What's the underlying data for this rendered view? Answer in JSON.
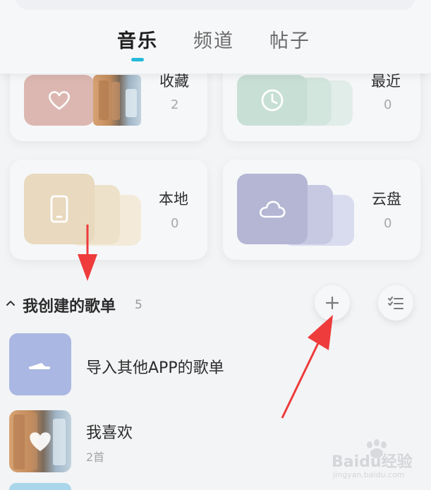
{
  "tabs": [
    {
      "label": "音乐",
      "active": true
    },
    {
      "label": "频道",
      "active": false
    },
    {
      "label": "帖子",
      "active": false
    }
  ],
  "cards": {
    "favorites": {
      "title": "收藏",
      "count": "2",
      "icon": "heart-icon",
      "color": "#dcb7b1"
    },
    "recent": {
      "title": "最近",
      "count": "0",
      "icon": "clock-icon",
      "color": "#c8dfd6"
    },
    "local": {
      "title": "本地",
      "count": "0",
      "icon": "phone-icon",
      "color": "#e8d9bf"
    },
    "cloud": {
      "title": "云盘",
      "count": "0",
      "icon": "cloud-icon",
      "color": "#b4b6d4"
    }
  },
  "section": {
    "toggle_icon": "caret-up-icon",
    "title": "我创建的歌单",
    "count": "5",
    "add_icon": "plus-icon",
    "manage_icon": "list-check-icon"
  },
  "playlists": [
    {
      "title": "导入其他APP的歌单",
      "subtitle": "",
      "icon": "import-arrow-icon",
      "color": "#a9b7e2"
    },
    {
      "title": "我喜欢",
      "subtitle": "2首",
      "icon": "heart-icon"
    }
  ],
  "annotation": {
    "arrow_color": "#ee3b3b"
  },
  "watermark": {
    "text": "Baidu经验",
    "sub": "jingyan.baidu.com"
  }
}
